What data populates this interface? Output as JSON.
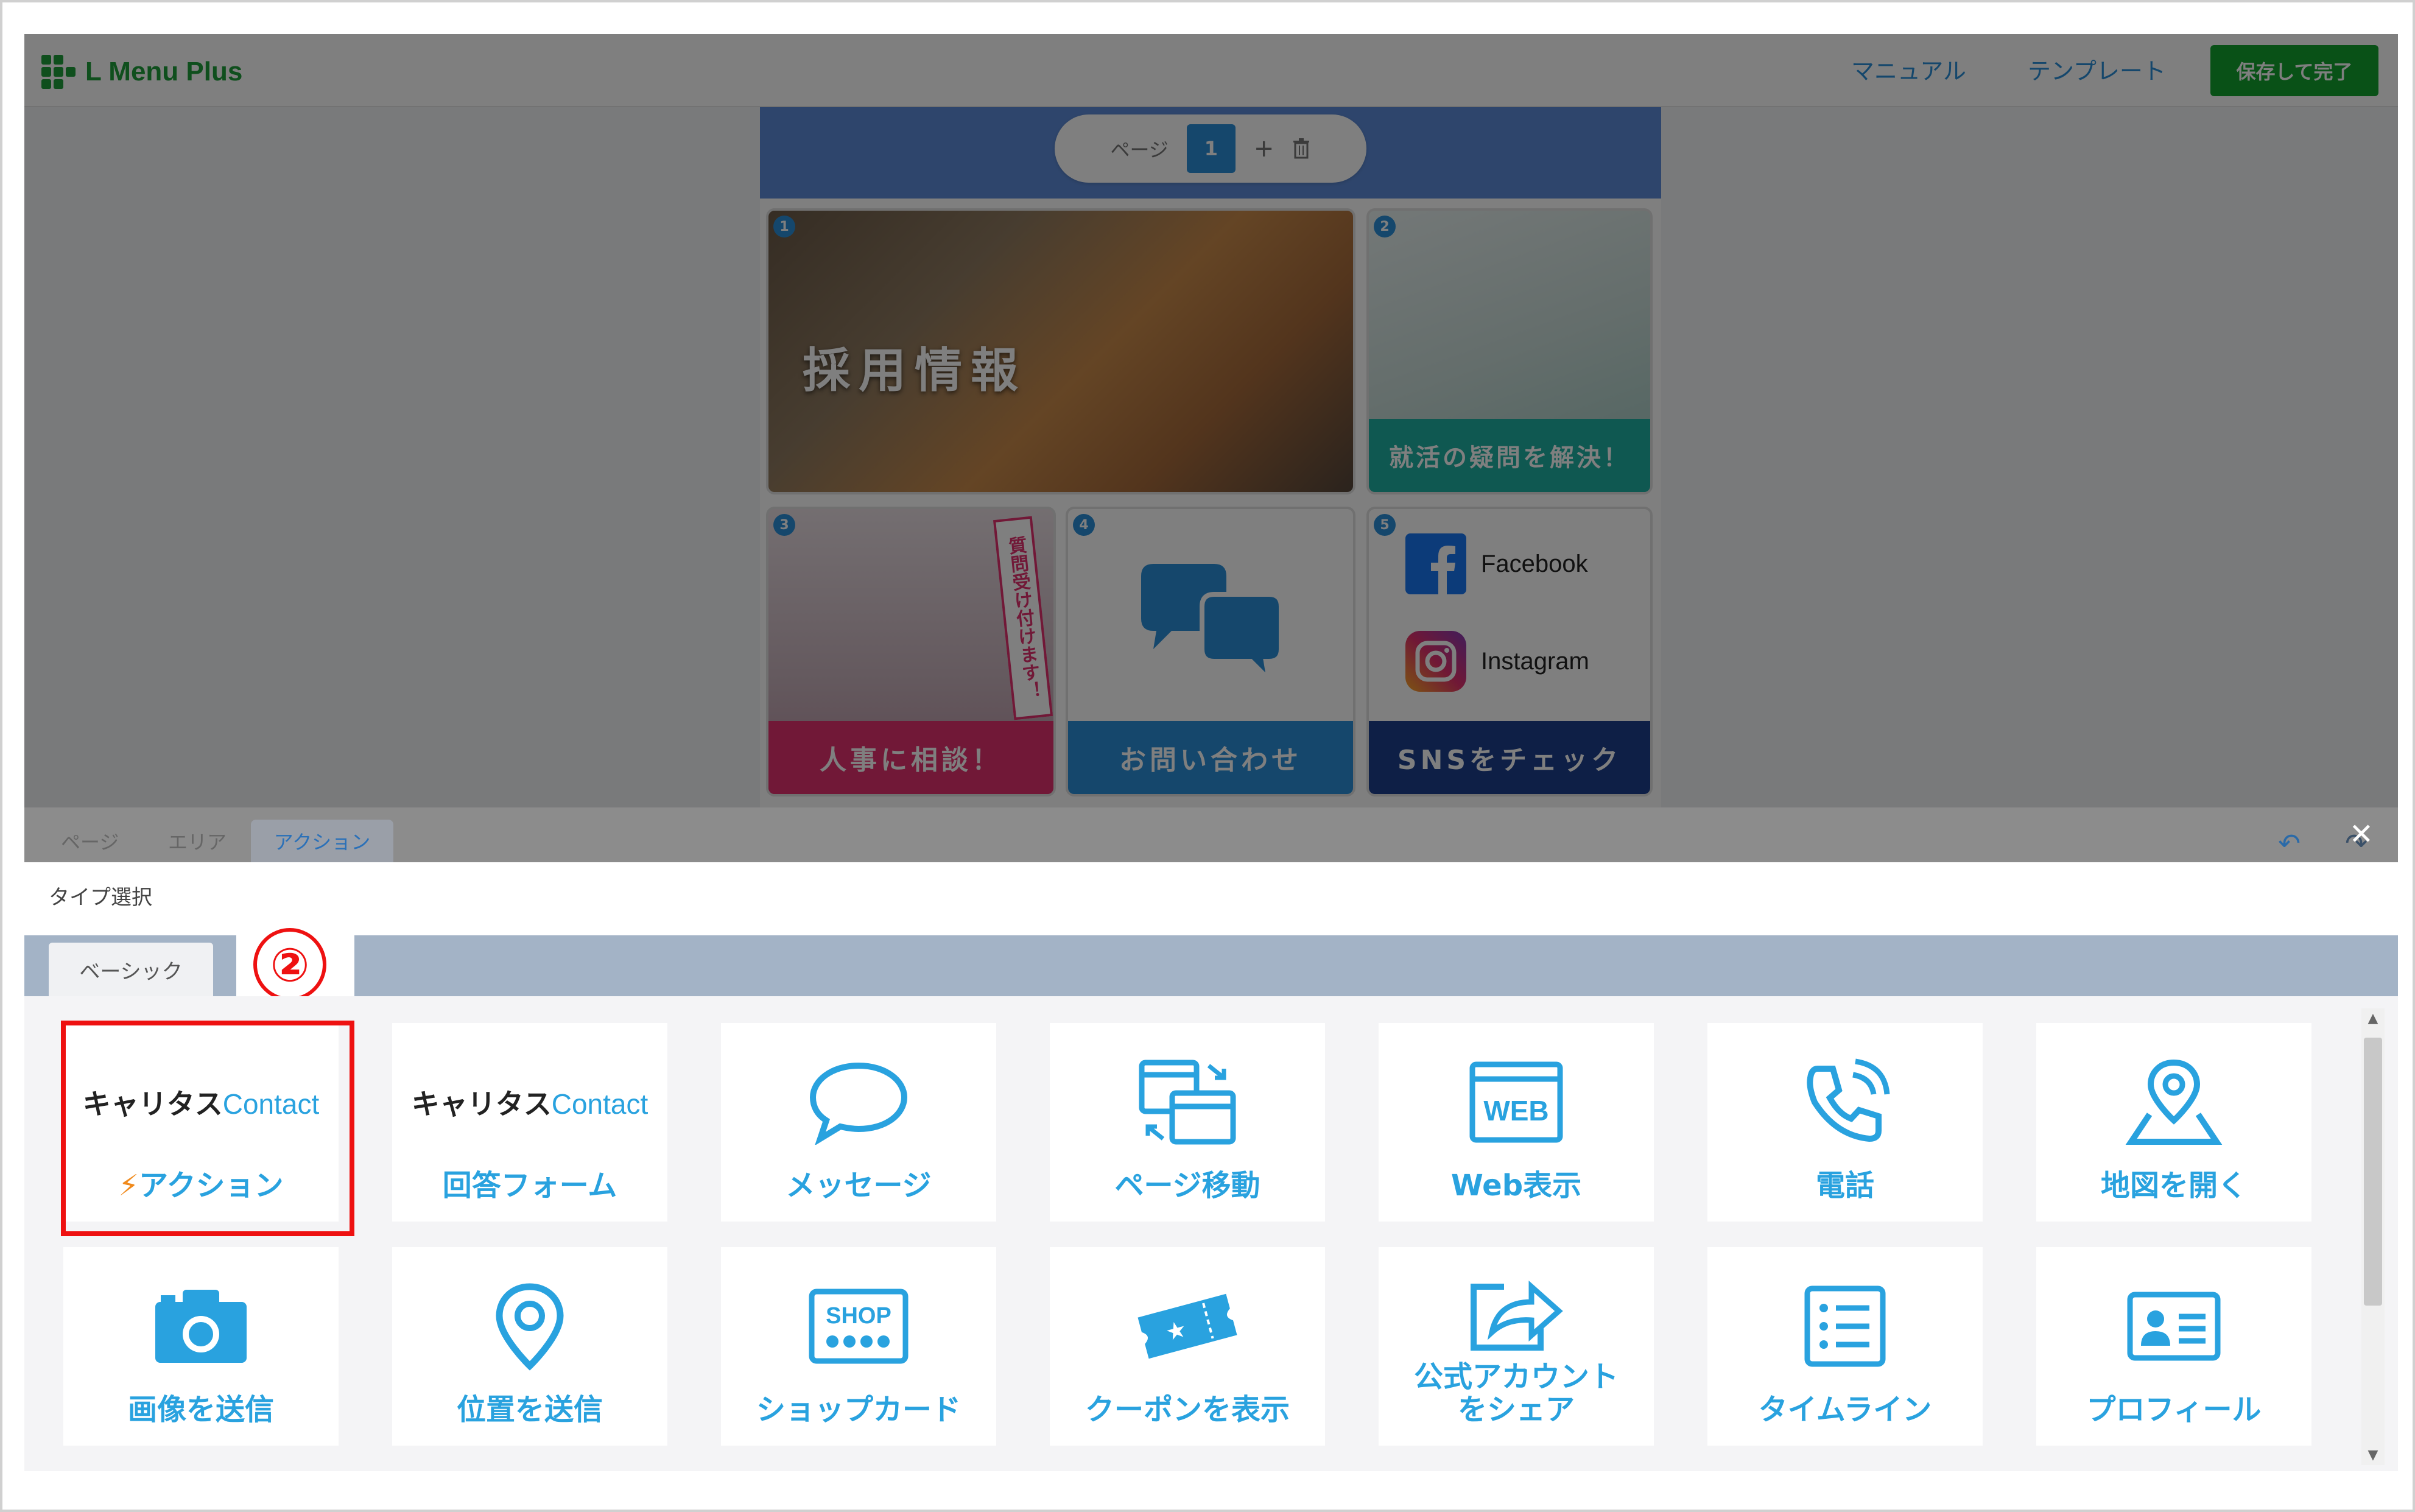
{
  "header": {
    "logo_text": "L Menu Plus",
    "manual_link": "マニュアル",
    "template_link": "テンプレート",
    "save_button": "保存して完了"
  },
  "pager": {
    "label": "ページ",
    "current_page": "1",
    "add_icon": "+",
    "delete_icon": "trash-icon"
  },
  "menu_tiles": {
    "tile1": {
      "badge": "1",
      "title": "採用情報"
    },
    "tile2": {
      "badge": "2",
      "bar": "就活の疑問を解決！"
    },
    "tile3": {
      "badge": "3",
      "tag": "質問受け付けます！",
      "bar": "人事に相談！"
    },
    "tile4": {
      "badge": "4",
      "bar": "お問い合わせ"
    },
    "tile5": {
      "badge": "5",
      "facebook": "Facebook",
      "instagram": "Instagram",
      "bar": "SNSをチェック"
    }
  },
  "editor_tabs": {
    "page": "ページ",
    "area": "エリア",
    "action": "アクション",
    "active": "アクション"
  },
  "type_select": {
    "label": "タイプ選択",
    "category_tab": "ベーシック",
    "callout_number": "②"
  },
  "action_cards": [
    {
      "brand_main": "キャリタス",
      "brand_sub": "Contact",
      "label": "アクション",
      "icon": "bolt-icon"
    },
    {
      "brand_main": "キャリタス",
      "brand_sub": "Contact",
      "label": "回答フォーム",
      "icon": "brand-logo"
    },
    {
      "label": "メッセージ",
      "icon": "speech-bubble-icon"
    },
    {
      "label": "ページ移動",
      "icon": "page-move-icon"
    },
    {
      "label": "Web表示",
      "icon": "web-icon"
    },
    {
      "label": "電話",
      "icon": "phone-icon"
    },
    {
      "label": "地図を開く",
      "icon": "map-pin-icon"
    },
    {
      "label": "画像を送信",
      "icon": "camera-icon"
    },
    {
      "label": "位置を送信",
      "icon": "location-icon"
    },
    {
      "label": "ショップカード",
      "icon": "shop-card-icon"
    },
    {
      "label": "クーポンを表示",
      "icon": "coupon-icon"
    },
    {
      "label": "公式アカウント をシェア",
      "icon": "share-icon"
    },
    {
      "label": "タイムライン",
      "icon": "timeline-icon"
    },
    {
      "label": "プロフィール",
      "icon": "profile-icon"
    }
  ],
  "icon_text": {
    "web": "WEB",
    "shop": "SHOP"
  },
  "colors": {
    "brand_green": "#1e9e3a",
    "accent_blue": "#29a2df",
    "highlight_red": "#ee1111"
  }
}
